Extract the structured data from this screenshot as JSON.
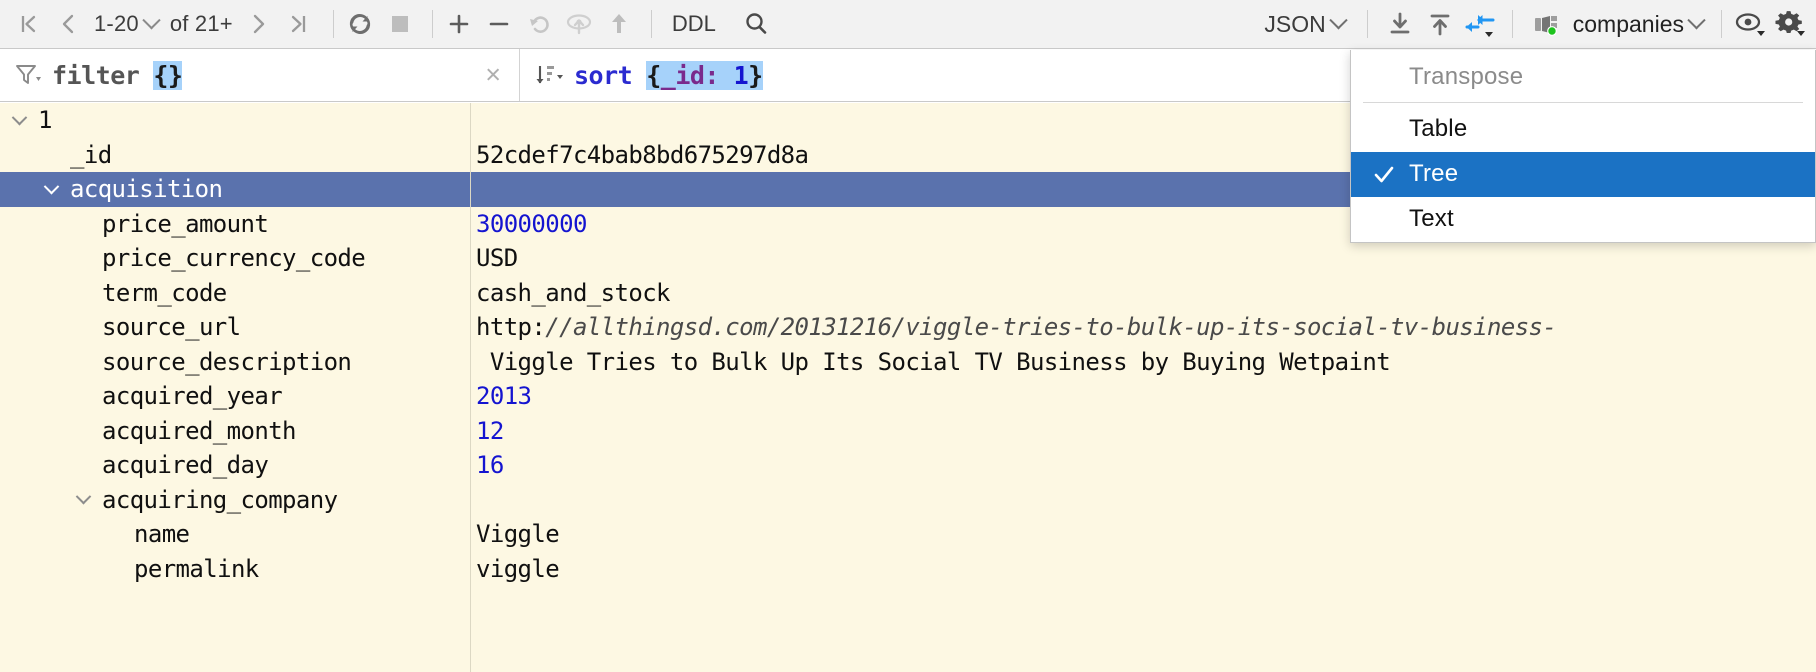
{
  "toolbar": {
    "first_page_icon": "first-page-icon",
    "prev_page_icon": "prev-page-icon",
    "page_range": "1-20",
    "page_total": "of 21+",
    "next_page_icon": "next-page-icon",
    "last_page_icon": "last-page-icon",
    "refresh_icon": "refresh-icon",
    "stop_icon": "stop-icon",
    "add_row_icon": "plus-icon",
    "delete_row_icon": "minus-icon",
    "revert_icon": "revert-icon",
    "revert_selected_icon": "revert-selected-icon",
    "submit_icon": "upload-arrow-icon",
    "ddl_label": "DDL",
    "search_icon": "search-icon",
    "view_format": "JSON",
    "export_icon": "download-icon",
    "import_icon": "upload-icon",
    "compare_icon": "compare-data-icon",
    "collection_icon": "database-collection-icon",
    "collection_name": "companies",
    "view_options_icon": "eye-icon",
    "settings_icon": "gear-icon"
  },
  "query_bar": {
    "filter_icon": "filter-icon",
    "filter_keyword": "filter",
    "filter_value": "{}",
    "clear_filter_icon": "×",
    "sort_icon": "sort-icon",
    "sort_keyword": "sort",
    "sort_open_brace": "{",
    "sort_field": "_id:",
    "sort_direction": "1",
    "sort_close_brace": "}"
  },
  "view_menu": {
    "header": "Transpose",
    "items": [
      {
        "label": "Table",
        "checked": false
      },
      {
        "label": "Tree",
        "checked": true
      },
      {
        "label": "Text",
        "checked": false
      }
    ],
    "check_glyph": "✓",
    "highlight_color": "#1b72c4"
  },
  "tree_rows": [
    {
      "key": "1",
      "value": "",
      "indent": 0,
      "twisty": true,
      "selected": false,
      "type": "index"
    },
    {
      "key": "_id",
      "value": "52cdef7c4bab8bd675297d8a",
      "indent": 1,
      "twisty": false,
      "selected": false,
      "type": "string"
    },
    {
      "key": "acquisition",
      "value": "",
      "indent": 1,
      "twisty": true,
      "selected": true,
      "type": "object"
    },
    {
      "key": "price_amount",
      "value": "30000000",
      "indent": 2,
      "twisty": false,
      "selected": false,
      "type": "number"
    },
    {
      "key": "price_currency_code",
      "value": "USD",
      "indent": 2,
      "twisty": false,
      "selected": false,
      "type": "string"
    },
    {
      "key": "term_code",
      "value": "cash_and_stock",
      "indent": 2,
      "twisty": false,
      "selected": false,
      "type": "string"
    },
    {
      "key": "source_url",
      "value": "http://allthingsd.com/20131216/viggle-tries-to-bulk-up-its-social-tv-business-",
      "indent": 2,
      "twisty": false,
      "selected": false,
      "type": "url",
      "scheme": "http:",
      "rest": "//allthingsd.com/20131216/viggle-tries-to-bulk-up-its-social-tv-business-"
    },
    {
      "key": "source_description",
      "value": " Viggle Tries to Bulk Up Its Social TV Business by Buying Wetpaint",
      "indent": 2,
      "twisty": false,
      "selected": false,
      "type": "string"
    },
    {
      "key": "acquired_year",
      "value": "2013",
      "indent": 2,
      "twisty": false,
      "selected": false,
      "type": "number"
    },
    {
      "key": "acquired_month",
      "value": "12",
      "indent": 2,
      "twisty": false,
      "selected": false,
      "type": "number"
    },
    {
      "key": "acquired_day",
      "value": "16",
      "indent": 2,
      "twisty": false,
      "selected": false,
      "type": "number"
    },
    {
      "key": "acquiring_company",
      "value": "",
      "indent": 2,
      "twisty": true,
      "selected": false,
      "type": "object"
    },
    {
      "key": "name",
      "value": "Viggle",
      "indent": 3,
      "twisty": false,
      "selected": false,
      "type": "string"
    },
    {
      "key": "permalink",
      "value": "viggle",
      "indent": 3,
      "twisty": false,
      "selected": false,
      "type": "string"
    }
  ],
  "colors": {
    "grid_background": "#fdf8e3",
    "selection": "#5a72ad",
    "number": "#1414d0",
    "highlight": "#a6d2fa"
  }
}
